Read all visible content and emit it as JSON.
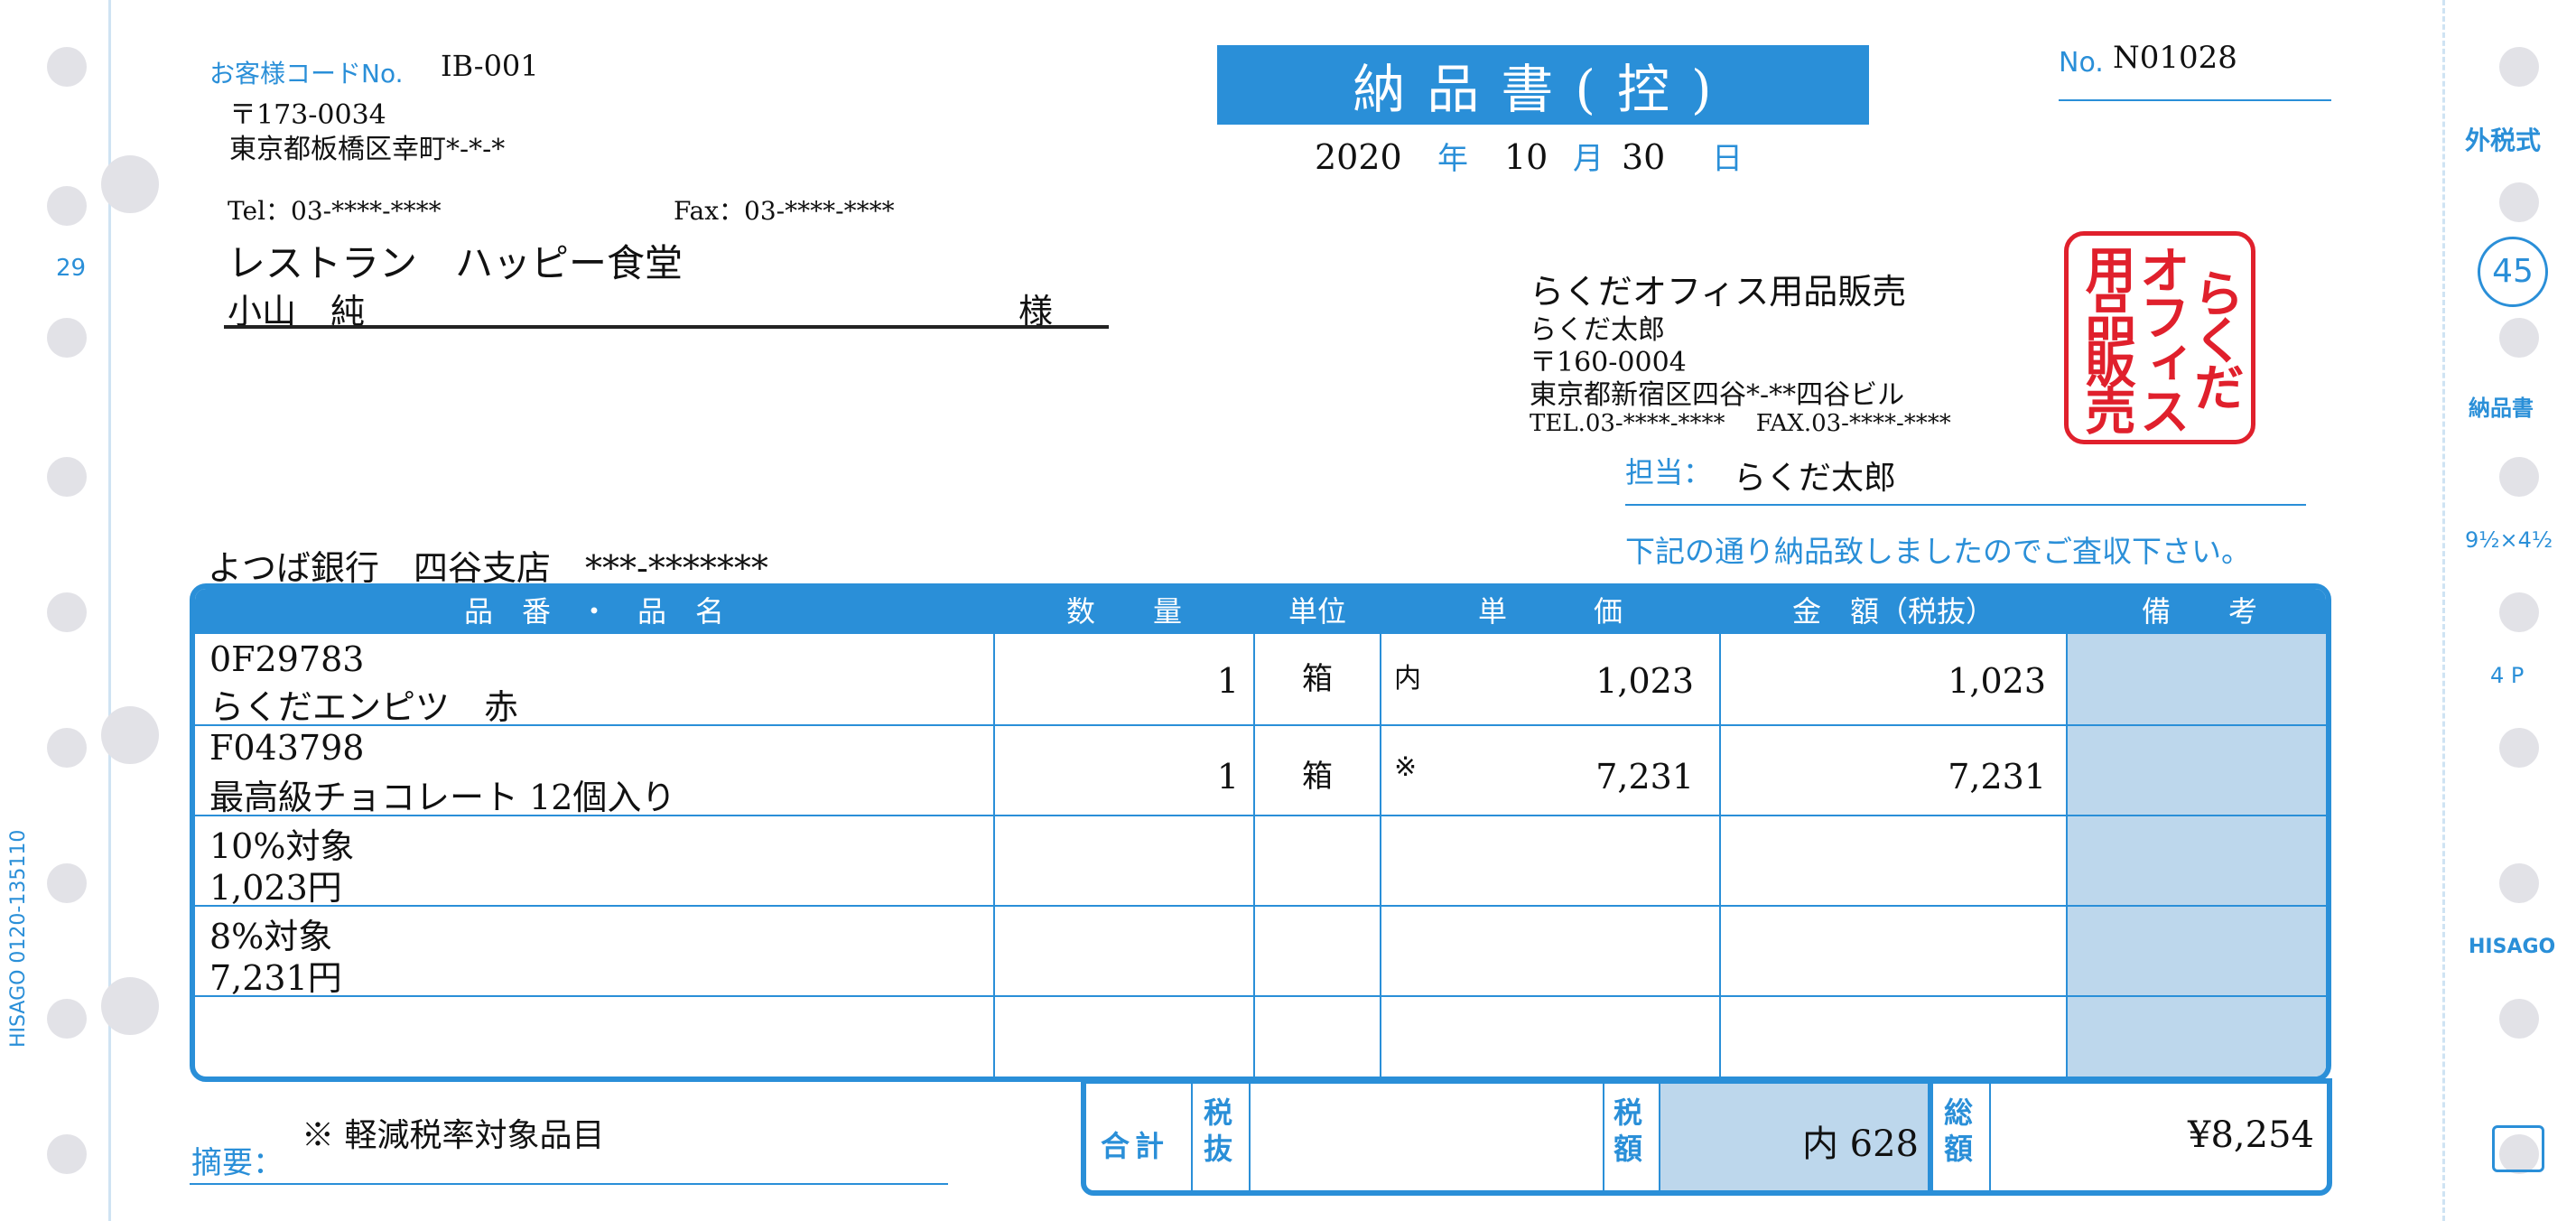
{
  "sidebar_left": {
    "number": "29",
    "phone": "HISAGO 0120-135110"
  },
  "sidebar_right": {
    "tax_type": "外税式",
    "badge": "45",
    "doc_name": "納品書",
    "size": "9½×4½",
    "pages": "4 P",
    "brand": "HISAGO"
  },
  "customer": {
    "code_label": "お客様コードNo.",
    "code": "IB-001",
    "postal": "〒173-0034",
    "address": "東京都板橋区幸町*-*-*",
    "tel": "Tel：03-****-****",
    "fax": "Fax：03-****-****",
    "company": "レストラン　ハッピー食堂",
    "person": "小山　純",
    "honorific": "様"
  },
  "title": "納品書(控)",
  "date": {
    "year": "2020",
    "year_label": "年",
    "month": "10",
    "month_label": "月",
    "day": "30",
    "day_label": "日"
  },
  "doc_no": {
    "label": "No.",
    "value": "N01028"
  },
  "issuer": {
    "company": "らくだオフィス用品販売",
    "person": "らくだ太郎",
    "postal": "〒160-0004",
    "address": "東京都新宿区四谷*-**四谷ビル",
    "tel_fax": "TEL.03-****-****　 FAX.03-****-****",
    "seal_text": [
      "らくだ",
      "オフィス",
      "用品販売"
    ],
    "contact_label": "担当：",
    "contact": "らくだ太郎",
    "message": "下記の通り納品致しましたのでご査収下さい。"
  },
  "bank": "よつば銀行　四谷支店　***-*******",
  "table": {
    "headers": [
      "品　番　・　品　名",
      "数　　量",
      "単位",
      "単　　　価",
      "金　額（税抜）",
      "備　　考"
    ],
    "rows": [
      {
        "code": "0F29783",
        "name": "らくだエンピツ　赤",
        "qty": "1",
        "unit": "箱",
        "mark": "内",
        "price": "1,023",
        "amount": "1,023"
      },
      {
        "code": "F043798",
        "name": "最高級チョコレート 12個入り",
        "qty": "1",
        "unit": "箱",
        "mark": "※",
        "price": "7,231",
        "amount": "7,231"
      },
      {
        "code": "10%対象",
        "name": "1,023円",
        "qty": "",
        "unit": "",
        "mark": "",
        "price": "",
        "amount": ""
      },
      {
        "code": "8%対象",
        "name": "7,231円",
        "qty": "",
        "unit": "",
        "mark": "",
        "price": "",
        "amount": ""
      },
      {
        "code": "",
        "name": "",
        "qty": "",
        "unit": "",
        "mark": "",
        "price": "",
        "amount": ""
      }
    ]
  },
  "totals": {
    "label": "合計",
    "pretax_label": "税抜",
    "pretax": "",
    "tax_label": "税額",
    "tax": "内 628",
    "grand_label": "総額",
    "grand": "¥8,254"
  },
  "memo": {
    "label": "摘要：",
    "text": "※ 軽減税率対象品目"
  },
  "colors": {
    "accent": "#2a8fd8",
    "shade": "#bdd7ec",
    "seal": "#e0202c"
  }
}
